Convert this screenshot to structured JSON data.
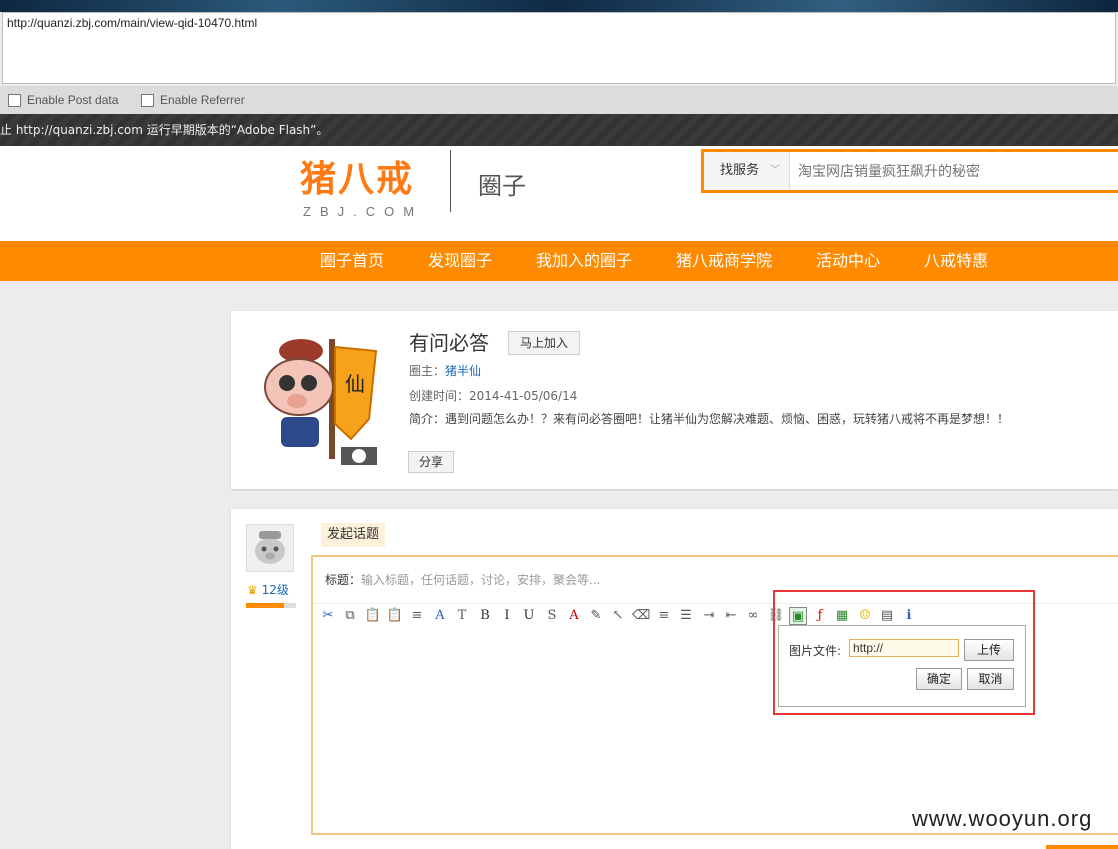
{
  "tool": {
    "url_value": "http://quanzi.zbj.com/main/view-qid-10470.html",
    "options": [
      "Enable Post data",
      "Enable Referrer"
    ]
  },
  "flash_notice": "止 http://quanzi.zbj.com 运行早期版本的“Adobe Flash”。",
  "header": {
    "logo_main": "猪八戒",
    "logo_sub": "ZBJ.COM",
    "site_name": "圈子",
    "search_category": "找服务",
    "search_placeholder": "淘宝网店销量疯狂飙升的秘密"
  },
  "nav": [
    "圈子首页",
    "发现圈子",
    "我加入的圈子",
    "猪八戒商学院",
    "活动中心",
    "八戒特惠"
  ],
  "circle": {
    "title": "有问必答",
    "join_label": "马上加入",
    "owner_label": "圈主：",
    "owner_name": "猪半仙",
    "created": "创建时间：2014-41-05/06/14",
    "intro": "简介：遇到问题怎么办！？来有问必答圈吧！让猪半仙为您解决难题、烦恼、困惑，玩转猪八戒将不再是梦想！！",
    "share_label": "分享",
    "mascot_text": "仙"
  },
  "post": {
    "level": "12级",
    "level_progress": 0.75,
    "new_topic_label": "发起话题",
    "title_label": "标题：",
    "title_placeholder": "输入标题，任何话题，讨论，安排，聚会等..."
  },
  "toolbar_icons": [
    "cut-icon",
    "copy-icon",
    "paste-icon",
    "paste-text-icon",
    "align-icon",
    "font-icon",
    "font-size-icon",
    "bold-icon",
    "italic-icon",
    "underline-icon",
    "strikethrough-icon",
    "font-color-icon",
    "highlight-icon",
    "pointer-icon",
    "eraser-icon",
    "justify-icon",
    "list-icon",
    "indent-icon",
    "outdent-icon",
    "link-icon",
    "unlink-icon",
    "image-icon",
    "flash-icon",
    "media-icon",
    "emoticon-icon",
    "table-icon",
    "info-icon"
  ],
  "toolbar_glyphs": [
    "✂",
    "⧉",
    "📋",
    "📋",
    "≡",
    "A",
    "T",
    "B",
    "I",
    "U",
    "S",
    "A",
    "✎",
    "↖",
    "⌫",
    "≡",
    "☰",
    "⇥",
    "⇤",
    "∞",
    "⛓",
    "▣",
    "ƒ",
    "▦",
    "☺",
    "▤",
    "ℹ"
  ],
  "image_dialog": {
    "label": "图片文件:",
    "url_value": "http://",
    "upload_label": "上传",
    "ok_label": "确定",
    "cancel_label": "取消"
  },
  "watermark": "www.wooyun.org",
  "colors": {
    "brand": "#ff8a00",
    "highlight": "#e53535",
    "link": "#1a6ab0"
  }
}
